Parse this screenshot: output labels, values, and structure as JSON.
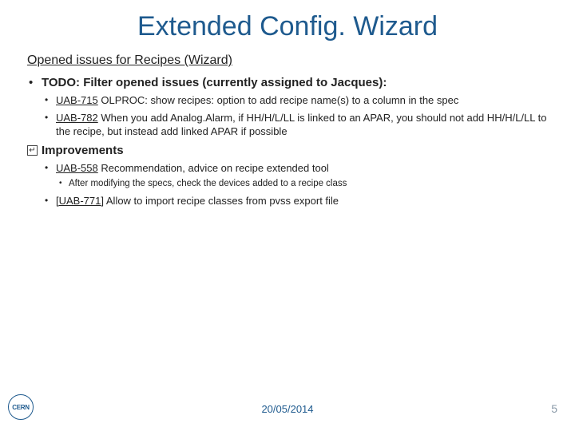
{
  "title": "Extended Config. Wizard",
  "section": "Opened issues for Recipes (Wizard)",
  "bullets": [
    {
      "label": "TODO: Filter opened issues (currently assigned to Jacques):",
      "bold": true,
      "sub": [
        {
          "link": "UAB-715",
          "text": " OLPROC: show recipes: option to add recipe name(s) to a column in the spec"
        },
        {
          "link": "UAB-782",
          "text": " When you add Analog.Alarm, if HH/H/L/LL is linked to an APAR, you should not add HH/H/L/LL to the recipe, but instead add linked APAR if possible"
        }
      ]
    },
    {
      "label": "Improvements",
      "bold": true,
      "icon": true,
      "sub": [
        {
          "link": "UAB-558",
          "text": " Recommendation, advice on recipe extended tool",
          "sub": [
            {
              "text": "After modifying the specs, check the devices added to a recipe class"
            }
          ]
        },
        {
          "link": "[UAB-771]",
          "text": " Allow to import recipe classes from pvss export file"
        }
      ]
    }
  ],
  "footer": {
    "logo": "CERN",
    "date": "20/05/2014",
    "page": "5"
  }
}
